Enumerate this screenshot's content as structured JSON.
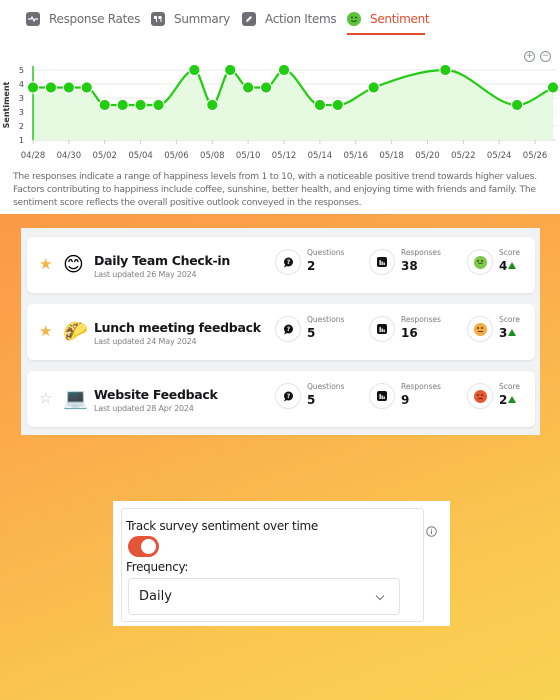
{
  "tabs": [
    {
      "label": "Response Rates",
      "icon": "pulse-icon",
      "active": false
    },
    {
      "label": "Summary",
      "icon": "quote-icon",
      "active": false
    },
    {
      "label": "Action Items",
      "icon": "pencil-icon",
      "active": false
    },
    {
      "label": "Sentiment",
      "icon": "smiley-icon",
      "active": true
    }
  ],
  "chart_controls": {
    "zoom_in": "+",
    "zoom_out": "−"
  },
  "chart_data": {
    "type": "line",
    "title": "",
    "xlabel": "",
    "ylabel": "Sentiment",
    "ylim": [
      1,
      5
    ],
    "y_tick_labels": [
      "5",
      "4",
      "3",
      "3",
      "2",
      "1"
    ],
    "y_ticks": [
      5,
      4.2,
      3.4,
      2.6,
      1.8,
      1
    ],
    "x_tick_labels": [
      "04/28",
      "04/30",
      "05/02",
      "05/04",
      "05/06",
      "05/08",
      "05/10",
      "05/12",
      "05/14",
      "05/16",
      "05/18",
      "05/20",
      "05/22",
      "05/24",
      "05/26"
    ],
    "x_range": [
      "04/28",
      "05/27"
    ],
    "grid": true,
    "series": [
      {
        "name": "Sentiment",
        "color": "#22cc11",
        "fill": "#e6f9e1",
        "points": [
          {
            "x": "04/28",
            "y": 4
          },
          {
            "x": "04/29",
            "y": 4
          },
          {
            "x": "04/30",
            "y": 4
          },
          {
            "x": "05/01",
            "y": 4
          },
          {
            "x": "05/02",
            "y": 3
          },
          {
            "x": "05/03",
            "y": 3
          },
          {
            "x": "05/04",
            "y": 3
          },
          {
            "x": "05/05",
            "y": 3
          },
          {
            "x": "05/07",
            "y": 5
          },
          {
            "x": "05/08",
            "y": 3
          },
          {
            "x": "05/09",
            "y": 5
          },
          {
            "x": "05/10",
            "y": 4
          },
          {
            "x": "05/11",
            "y": 4
          },
          {
            "x": "05/12",
            "y": 5
          },
          {
            "x": "05/14",
            "y": 3
          },
          {
            "x": "05/15",
            "y": 3
          },
          {
            "x": "05/17",
            "y": 4
          },
          {
            "x": "05/21",
            "y": 5
          },
          {
            "x": "05/25",
            "y": 3
          },
          {
            "x": "05/27",
            "y": 4
          }
        ]
      }
    ]
  },
  "summary_text": "The responses indicate a range of happiness levels from 1 to 10, with a noticeable positive trend towards higher values. Factors contributing to happiness include coffee, sunshine, better health, and enjoying time with friends and family. The sentiment score reflects the overall positive outlook conveyed in the responses.",
  "surveys": [
    {
      "title": "Daily Team Check-in",
      "updated": "Last updated 26 May 2024",
      "starred": true,
      "emoji": "😊",
      "emoji_name": "smiling-face-icon",
      "questions_label": "Questions",
      "questions": "2",
      "responses_label": "Responses",
      "responses": "38",
      "score_label": "Score",
      "score": "4",
      "score_face": "happy",
      "score_color": "#7cc84a",
      "trend": "up"
    },
    {
      "title": "Lunch meeting feedback",
      "updated": "Last updated 24 May 2024",
      "starred": true,
      "emoji": "🌮",
      "emoji_name": "taco-icon",
      "questions_label": "Questions",
      "questions": "5",
      "responses_label": "Responses",
      "responses": "16",
      "score_label": "Score",
      "score": "3",
      "score_face": "neutral",
      "score_color": "#f5a941",
      "trend": "up"
    },
    {
      "title": "Website Feedback",
      "updated": "Last updated 28 Apr 2024",
      "starred": false,
      "emoji": "💻",
      "emoji_name": "laptop-icon",
      "questions_label": "Questions",
      "questions": "5",
      "responses_label": "Responses",
      "responses": "9",
      "score_label": "Score",
      "score": "2",
      "score_face": "sad",
      "score_color": "#e85a2e",
      "trend": "up"
    }
  ],
  "settings": {
    "track_label": "Track survey sentiment over time",
    "toggle_on": true,
    "frequency_label": "Frequency:",
    "frequency_value": "Daily"
  },
  "colors": {
    "accent": "#e54b2d",
    "chart_line": "#22cc11",
    "toggle": "#e4553a",
    "star": "#f5b443",
    "trend_up": "#17911f"
  }
}
